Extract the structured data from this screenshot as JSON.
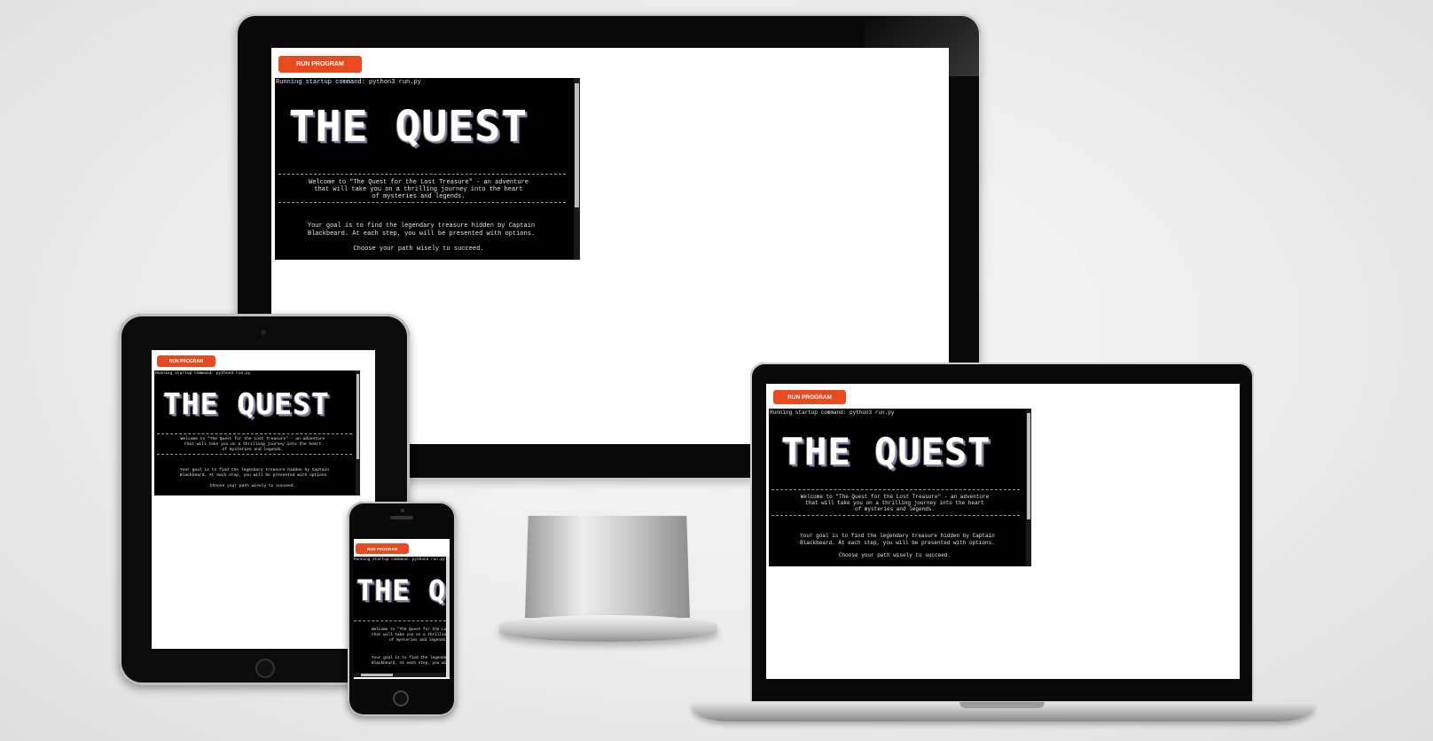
{
  "run_button_label": "RUN PROGRAM",
  "terminal": {
    "startup_line": "Running startup command: python3 run.py",
    "logo": "THE QUEST",
    "welcome": [
      "Welcome to \"The Quest for the Lost Treasure\" - an adventure",
      "that will take you on a thrilling journey into the heart",
      "of mysteries and legends."
    ],
    "goal": [
      "Your goal is to find the legendary treasure hidden by Captain",
      "Blackbeard. At each step, you will be presented with options."
    ],
    "choose": "Choose your path wisely to succeed."
  },
  "colors": {
    "run_button": "#e8491d",
    "terminal_bg": "#000000",
    "page_bg": "#ebebeb",
    "device_body": "#0a0a0a"
  }
}
